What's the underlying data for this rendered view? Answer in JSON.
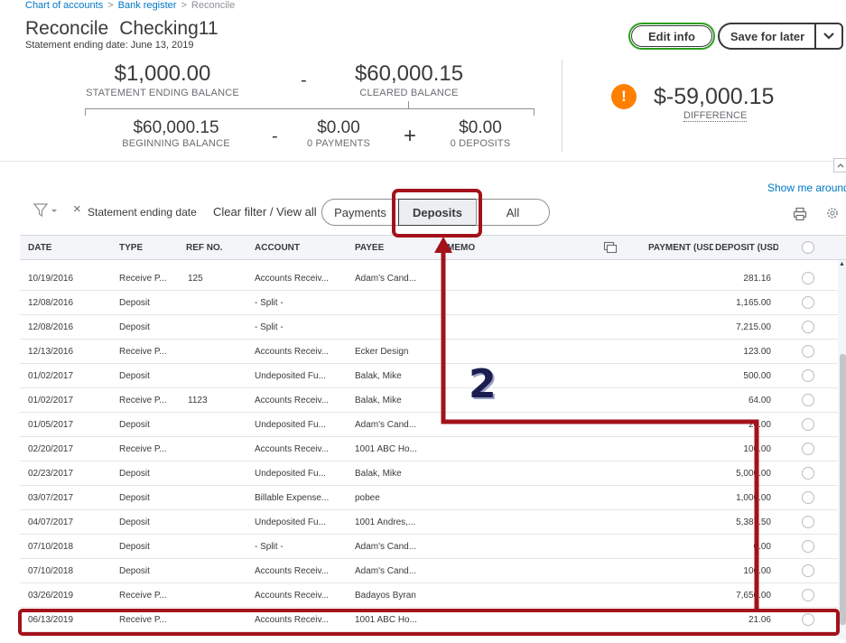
{
  "breadcrumb": {
    "items": [
      "Chart of accounts",
      "Bank register",
      "Reconcile"
    ],
    "separator": ">"
  },
  "header": {
    "title": "Reconcile",
    "account": "Checking11",
    "subtitle": "Statement ending date: June 13, 2019",
    "edit_info": "Edit info",
    "save_for_later": "Save for later"
  },
  "summary": {
    "statement_ending_balance": "$1,000.00",
    "statement_ending_balance_label": "STATEMENT ENDING BALANCE",
    "minus_1": "-",
    "cleared_balance": "$60,000.15",
    "cleared_balance_label": "CLEARED BALANCE",
    "beginning_balance": "$60,000.15",
    "beginning_balance_label": "BEGINNING BALANCE",
    "minus_2": "-",
    "payments": "$0.00",
    "payments_label": "0 PAYMENTS",
    "plus": "+",
    "deposits": "$0.00",
    "deposits_label": "0 DEPOSITS",
    "warning_glyph": "!",
    "difference": "$-59,000.15",
    "difference_label": "DIFFERENCE"
  },
  "help": {
    "show_me_around": "Show me around"
  },
  "filters": {
    "clear_x": "×",
    "active_filter": "Statement ending date",
    "clear_filter": "Clear filter / View all"
  },
  "tabs": [
    {
      "label": "Payments"
    },
    {
      "label": "Deposits",
      "selected": true
    },
    {
      "label": "All"
    }
  ],
  "table": {
    "columns": {
      "date": "DATE",
      "type": "TYPE",
      "ref": "REF NO.",
      "account": "ACCOUNT",
      "payee": "PAYEE",
      "memo": "MEMO",
      "payment": "PAYMENT (USD)",
      "deposit": "DEPOSIT (USD)"
    },
    "rows": [
      {
        "date": "10/19/2016",
        "type": "Receive P...",
        "ref": "125",
        "account": "Accounts Receiv...",
        "payee": "Adam's Cand...",
        "deposit": "281.16"
      },
      {
        "date": "12/08/2016",
        "type": "Deposit",
        "ref": "",
        "account": "- Split -",
        "payee": "",
        "deposit": "1,165.00"
      },
      {
        "date": "12/08/2016",
        "type": "Deposit",
        "ref": "",
        "account": "- Split -",
        "payee": "",
        "deposit": "7,215.00"
      },
      {
        "date": "12/13/2016",
        "type": "Receive P...",
        "ref": "",
        "account": "Accounts Receiv...",
        "payee": "Ecker Design",
        "deposit": "123.00"
      },
      {
        "date": "01/02/2017",
        "type": "Deposit",
        "ref": "",
        "account": "Undeposited Fu...",
        "payee": "Balak, Mike",
        "deposit": "500.00"
      },
      {
        "date": "01/02/2017",
        "type": "Receive P...",
        "ref": "1123",
        "account": "Accounts Receiv...",
        "payee": "Balak, Mike",
        "deposit": "64.00"
      },
      {
        "date": "01/05/2017",
        "type": "Deposit",
        "ref": "",
        "account": "Undeposited Fu...",
        "payee": "Adam's Cand...",
        "deposit": "20.00"
      },
      {
        "date": "02/20/2017",
        "type": "Receive P...",
        "ref": "",
        "account": "Accounts Receiv...",
        "payee": "1001 ABC Ho...",
        "deposit": "100.00"
      },
      {
        "date": "02/23/2017",
        "type": "Deposit",
        "ref": "",
        "account": "Undeposited Fu...",
        "payee": "Balak, Mike",
        "deposit": "5,000.00"
      },
      {
        "date": "03/07/2017",
        "type": "Deposit",
        "ref": "",
        "account": "Billable Expense...",
        "payee": "pobee",
        "deposit": "1,000.00"
      },
      {
        "date": "04/07/2017",
        "type": "Deposit",
        "ref": "",
        "account": "Undeposited Fu...",
        "payee": "1001 Andres,...",
        "deposit": "5,387.50"
      },
      {
        "date": "07/10/2018",
        "type": "Deposit",
        "ref": "",
        "account": "- Split -",
        "payee": "Adam's Cand...",
        "deposit": "0.00"
      },
      {
        "date": "07/10/2018",
        "type": "Deposit",
        "ref": "",
        "account": "Accounts Receiv...",
        "payee": "Adam's Cand...",
        "deposit": "100.00"
      },
      {
        "date": "03/26/2019",
        "type": "Receive P...",
        "ref": "",
        "account": "Accounts Receiv...",
        "payee": "Badayos Byran",
        "deposit": "7,650.00"
      },
      {
        "date": "06/13/2019",
        "type": "Receive P...",
        "ref": "",
        "account": "Accounts Receiv...",
        "payee": "1001 ABC Ho...",
        "deposit": "21.06"
      }
    ]
  },
  "annotation": {
    "step": "2",
    "color": "#a3121b"
  },
  "colors": {
    "link": "#0077c5",
    "warning": "#ff8000",
    "edit_border": "#2ca01c"
  }
}
